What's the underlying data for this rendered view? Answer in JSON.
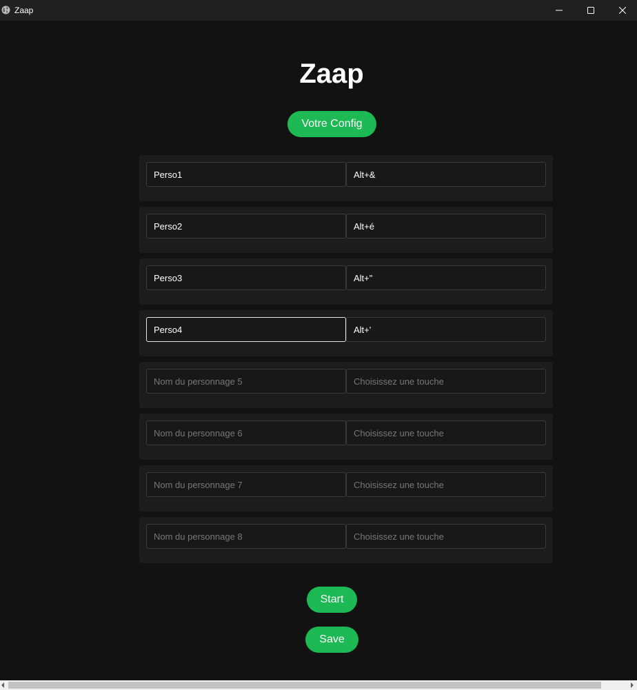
{
  "window": {
    "title": "Zaap",
    "icon": "globe-icon",
    "controls": [
      "minimize-icon",
      "maximize-icon",
      "close-icon"
    ]
  },
  "header": {
    "title": "Zaap",
    "config_label": "Votre Config"
  },
  "characters": [
    {
      "name": "Perso1",
      "name_placeholder": "",
      "key": "Alt+&",
      "key_placeholder": ""
    },
    {
      "name": "Perso2",
      "name_placeholder": "",
      "key": "Alt+é",
      "key_placeholder": ""
    },
    {
      "name": "Perso3",
      "name_placeholder": "",
      "key": "Alt+\"",
      "key_placeholder": ""
    },
    {
      "name": "Perso4",
      "name_placeholder": "",
      "key": "Alt+'",
      "key_placeholder": ""
    },
    {
      "name": "",
      "name_placeholder": "Nom du personnage 5",
      "key": "",
      "key_placeholder": "Choisissez une touche"
    },
    {
      "name": "",
      "name_placeholder": "Nom du personnage 6",
      "key": "",
      "key_placeholder": "Choisissez une touche"
    },
    {
      "name": "",
      "name_placeholder": "Nom du personnage 7",
      "key": "",
      "key_placeholder": "Choisissez une touche"
    },
    {
      "name": "",
      "name_placeholder": "Nom du personnage 8",
      "key": "",
      "key_placeholder": "Choisissez une touche"
    }
  ],
  "actions": {
    "start_label": "Start",
    "save_label": "Save"
  },
  "colors": {
    "accent": "#1db954",
    "background": "#121212",
    "row_background": "#1c1c1c",
    "titlebar": "#202020"
  }
}
